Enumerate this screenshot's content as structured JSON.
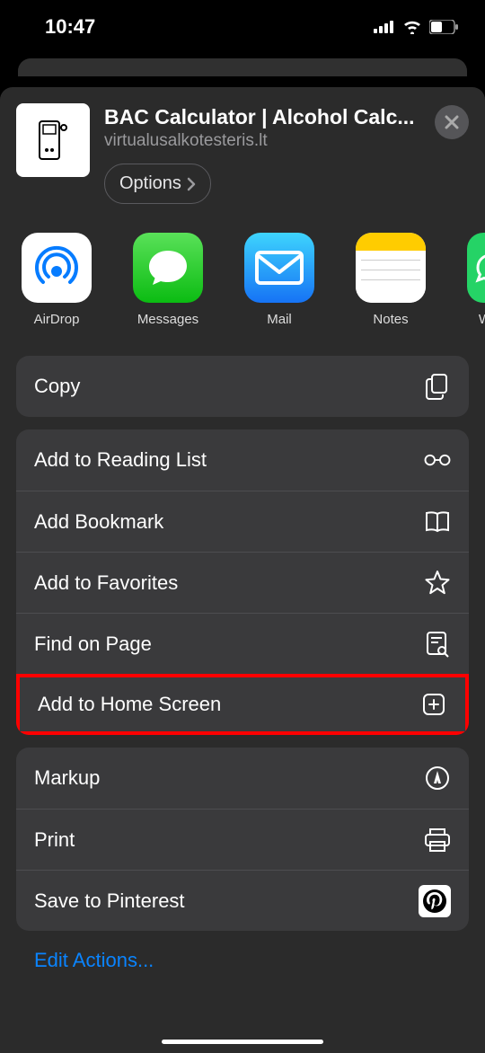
{
  "status": {
    "time": "10:47"
  },
  "header": {
    "title": "BAC Calculator | Alcohol Calc...",
    "url": "virtualusalkotesteris.lt",
    "options_label": "Options"
  },
  "share_targets": [
    {
      "label": "AirDrop"
    },
    {
      "label": "Messages"
    },
    {
      "label": "Mail"
    },
    {
      "label": "Notes"
    },
    {
      "label": "W"
    }
  ],
  "groups": [
    {
      "rows": [
        {
          "label": "Copy",
          "icon": "copy"
        }
      ]
    },
    {
      "rows": [
        {
          "label": "Add to Reading List",
          "icon": "glasses"
        },
        {
          "label": "Add Bookmark",
          "icon": "book"
        },
        {
          "label": "Add to Favorites",
          "icon": "star"
        },
        {
          "label": "Find on Page",
          "icon": "find"
        },
        {
          "label": "Add to Home Screen",
          "icon": "plus-square",
          "highlighted": true
        }
      ]
    },
    {
      "rows": [
        {
          "label": "Markup",
          "icon": "markup"
        },
        {
          "label": "Print",
          "icon": "print"
        },
        {
          "label": "Save to Pinterest",
          "icon": "pinterest"
        }
      ]
    }
  ],
  "edit_actions_label": "Edit Actions..."
}
